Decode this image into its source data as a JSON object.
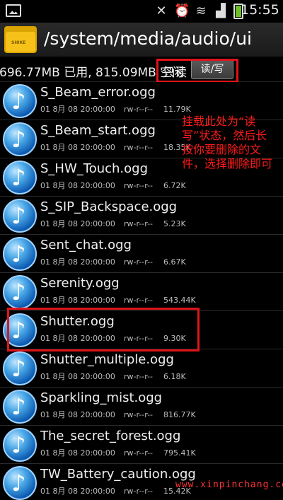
{
  "status_bar": {
    "time": "15:55",
    "icons": [
      "image-icon",
      "mute-icon",
      "alarm-icon",
      "wifi-icon",
      "signal-icon",
      "battery-icon"
    ]
  },
  "title_bar": {
    "path": "/system/media/audio/ui",
    "folder_icon_label": "SHIKE"
  },
  "info_bar": {
    "storage": "696.77MB 已用, 815.09MB 空闲",
    "mode": "只读",
    "toggle_button": "读/写"
  },
  "annotation": "挂载此处为“读写”状态，然后长按你要删除的文件，选择删除即可",
  "watermark": "www.xinpinchang.com",
  "files": [
    {
      "name": "S_Beam_error.ogg",
      "date": "01 8月 08 20:00:00",
      "perm": "rw-r--r--",
      "size": "11.79K"
    },
    {
      "name": "S_Beam_start.ogg",
      "date": "01 8月 08 20:00:00",
      "perm": "rw-r--r--",
      "size": "18.35K"
    },
    {
      "name": "S_HW_Touch.ogg",
      "date": "01 8月 08 20:00:00",
      "perm": "rw-r--r--",
      "size": "6.72K"
    },
    {
      "name": "S_SIP_Backspace.ogg",
      "date": "01 8月 08 20:00:00",
      "perm": "rw-r--r--",
      "size": "5.23K"
    },
    {
      "name": "Sent_chat.ogg",
      "date": "01 8月 08 20:00:00",
      "perm": "rw-r--r--",
      "size": "6.67K"
    },
    {
      "name": "Serenity.ogg",
      "date": "01 8月 08 20:00:00",
      "perm": "rw-r--r--",
      "size": "543.44K"
    },
    {
      "name": "Shutter.ogg",
      "date": "01 8月 08 20:00:00",
      "perm": "rw-r--r--",
      "size": "9.30K"
    },
    {
      "name": "Shutter_multiple.ogg",
      "date": "01 8月 08 20:00:00",
      "perm": "rw-r--r--",
      "size": "6.18K"
    },
    {
      "name": "Sparkling_mist.ogg",
      "date": "01 8月 08 20:00:00",
      "perm": "rw-r--r--",
      "size": "816.77K"
    },
    {
      "name": "The_secret_forest.ogg",
      "date": "01 8月 08 20:00:00",
      "perm": "rw-r--r--",
      "size": "795.41K"
    },
    {
      "name": "TW_Battery_caution.ogg",
      "date": "01 8月 08 20:00:00",
      "perm": "rw-r--r--",
      "size": "15.42K"
    }
  ],
  "colors": {
    "highlight": "#e0141a",
    "annotation": "#ff1a1a",
    "battery": "#6fbf2a",
    "folder": "#f6c21a"
  }
}
